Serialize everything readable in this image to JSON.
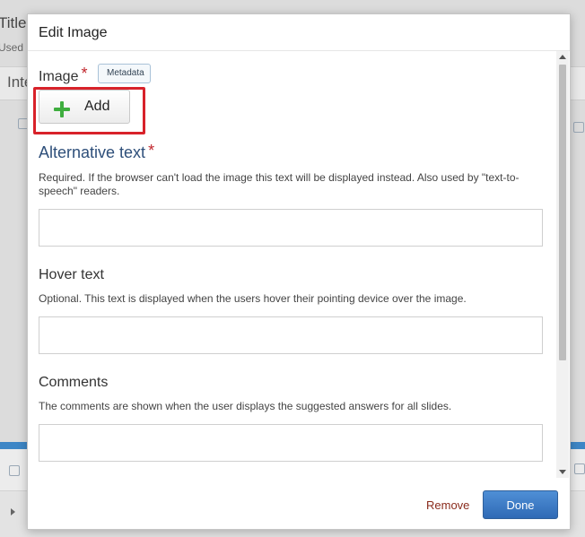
{
  "background": {
    "title": "Title",
    "used": "Used",
    "tab": "Inte"
  },
  "dialog": {
    "title": "Edit Image",
    "image": {
      "label": "Image",
      "required_marker": "*",
      "metadata_label": "Metadata",
      "add_label": "Add",
      "add_icon": "plus-icon",
      "highlight_color": "#d8222a"
    },
    "alt_text": {
      "label": "Alternative text",
      "required_marker": "*",
      "description": "Required. If the browser can't load the image this text will be displayed instead. Also used by \"text-to-speech\" readers.",
      "value": ""
    },
    "hover_text": {
      "label": "Hover text",
      "description": "Optional. This text is displayed when the users hover their pointing device over the image.",
      "value": ""
    },
    "comments": {
      "label": "Comments",
      "description": "The comments are shown when the user displays the suggested answers for all slides.",
      "value": ""
    },
    "footer": {
      "remove_label": "Remove",
      "done_label": "Done"
    }
  },
  "colors": {
    "accent": "#3d7cc9",
    "heading_blue": "#2e4f7a",
    "required_red": "#c1272d",
    "add_plus_green": "#3fae3f"
  }
}
